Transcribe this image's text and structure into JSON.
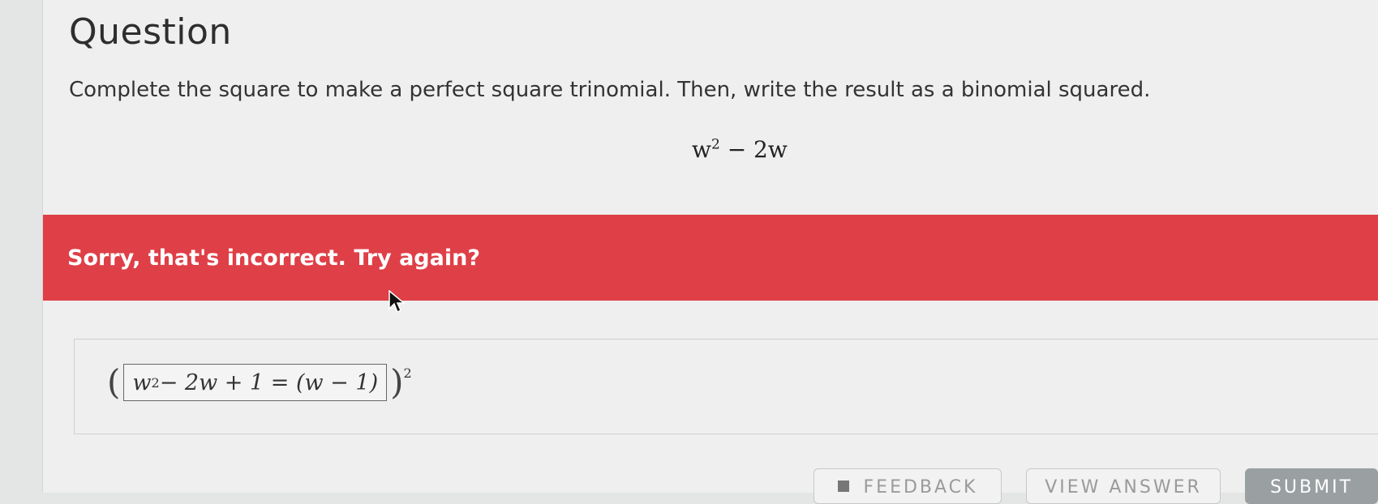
{
  "question": {
    "title": "Question",
    "prompt": "Complete the square to make a perfect square trinomial. Then, write the result as a binomial squared.",
    "expression_base": "w",
    "expression_exp": "2",
    "expression_rest": " − 2w"
  },
  "feedback": {
    "message": "Sorry, that's incorrect. Try again?",
    "color": "#df3f47"
  },
  "answer": {
    "open_paren": "(",
    "field_base": "w",
    "field_exp": "2",
    "field_rest": " − 2w + 1 = (w − 1)",
    "close_paren": ")",
    "exponent": "2"
  },
  "buttons": {
    "feedback": "FEEDBACK",
    "view_answer": "VIEW ANSWER",
    "submit": "SUBMIT"
  },
  "icons": {
    "cursor": "mouse-pointer-icon",
    "feedback": "feedback-icon"
  }
}
